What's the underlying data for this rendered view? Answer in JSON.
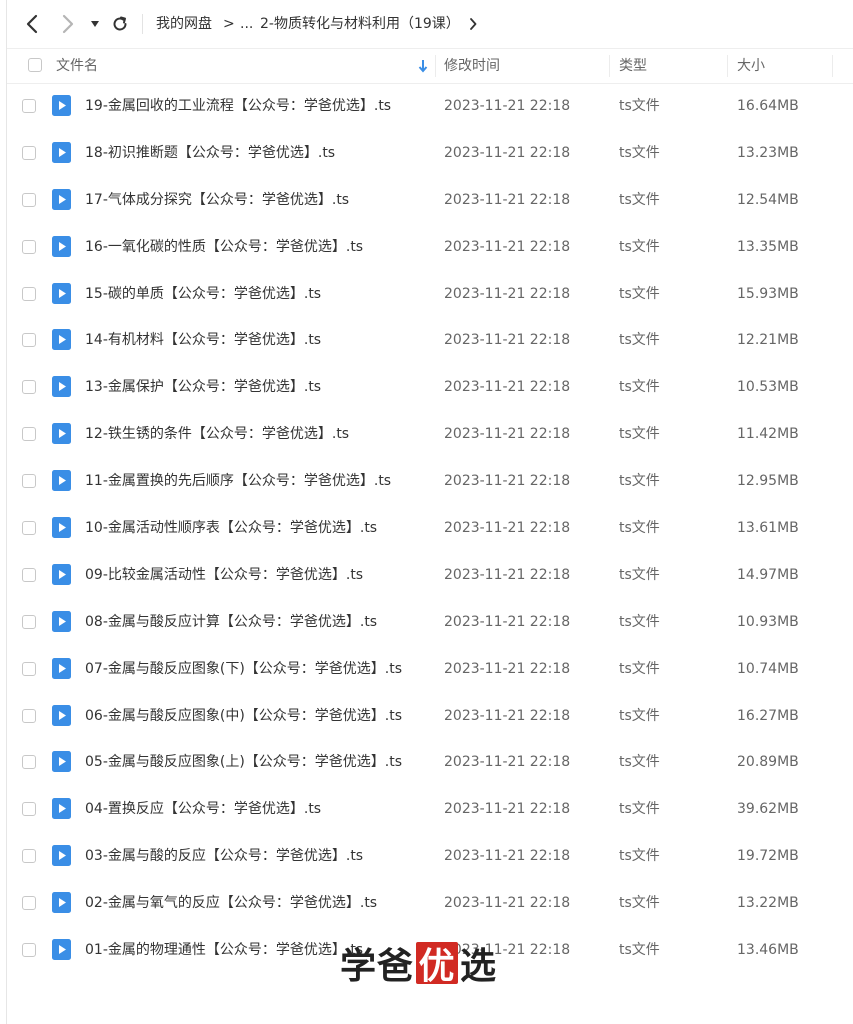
{
  "nav": {
    "back_icon": "chevron-left-icon",
    "forward_icon": "chevron-right-icon",
    "dropdown_icon": "caret-down-icon",
    "refresh_icon": "refresh-icon",
    "breadcrumb_root": "我的网盘",
    "breadcrumb_sep": ">",
    "breadcrumb_ellipsis": "...",
    "breadcrumb_current": "2-物质转化与材料利用（19课）",
    "breadcrumb_next_icon": "chevron-right-icon"
  },
  "header": {
    "name": "文件名",
    "sort_icon": "arrow-down-icon",
    "modified": "修改时间",
    "type": "类型",
    "size": "大小"
  },
  "colors": {
    "accent": "#3a8ee6",
    "watermark_red": "#d12a23"
  },
  "files": [
    {
      "name": "19-金属回收的工业流程【公众号：学爸优选】.ts",
      "date": "2023-11-21 22:18",
      "type": "ts文件",
      "size": "16.64MB"
    },
    {
      "name": "18-初识推断题【公众号：学爸优选】.ts",
      "date": "2023-11-21 22:18",
      "type": "ts文件",
      "size": "13.23MB"
    },
    {
      "name": "17-气体成分探究【公众号：学爸优选】.ts",
      "date": "2023-11-21 22:18",
      "type": "ts文件",
      "size": "12.54MB"
    },
    {
      "name": "16-一氧化碳的性质【公众号：学爸优选】.ts",
      "date": "2023-11-21 22:18",
      "type": "ts文件",
      "size": "13.35MB"
    },
    {
      "name": "15-碳的单质【公众号：学爸优选】.ts",
      "date": "2023-11-21 22:18",
      "type": "ts文件",
      "size": "15.93MB"
    },
    {
      "name": "14-有机材料【公众号：学爸优选】.ts",
      "date": "2023-11-21 22:18",
      "type": "ts文件",
      "size": "12.21MB"
    },
    {
      "name": "13-金属保护【公众号：学爸优选】.ts",
      "date": "2023-11-21 22:18",
      "type": "ts文件",
      "size": "10.53MB"
    },
    {
      "name": "12-铁生锈的条件【公众号：学爸优选】.ts",
      "date": "2023-11-21 22:18",
      "type": "ts文件",
      "size": "11.42MB"
    },
    {
      "name": "11-金属置换的先后顺序【公众号：学爸优选】.ts",
      "date": "2023-11-21 22:18",
      "type": "ts文件",
      "size": "12.95MB"
    },
    {
      "name": "10-金属活动性顺序表【公众号：学爸优选】.ts",
      "date": "2023-11-21 22:18",
      "type": "ts文件",
      "size": "13.61MB"
    },
    {
      "name": "09-比较金属活动性【公众号：学爸优选】.ts",
      "date": "2023-11-21 22:18",
      "type": "ts文件",
      "size": "14.97MB"
    },
    {
      "name": "08-金属与酸反应计算【公众号：学爸优选】.ts",
      "date": "2023-11-21 22:18",
      "type": "ts文件",
      "size": "10.93MB"
    },
    {
      "name": "07-金属与酸反应图象(下)【公众号：学爸优选】.ts",
      "date": "2023-11-21 22:18",
      "type": "ts文件",
      "size": "10.74MB"
    },
    {
      "name": "06-金属与酸反应图象(中)【公众号：学爸优选】.ts",
      "date": "2023-11-21 22:18",
      "type": "ts文件",
      "size": "16.27MB"
    },
    {
      "name": "05-金属与酸反应图象(上)【公众号：学爸优选】.ts",
      "date": "2023-11-21 22:18",
      "type": "ts文件",
      "size": "20.89MB"
    },
    {
      "name": "04-置换反应【公众号：学爸优选】.ts",
      "date": "2023-11-21 22:18",
      "type": "ts文件",
      "size": "39.62MB"
    },
    {
      "name": "03-金属与酸的反应【公众号：学爸优选】.ts",
      "date": "2023-11-21 22:18",
      "type": "ts文件",
      "size": "19.72MB"
    },
    {
      "name": "02-金属与氧气的反应【公众号：学爸优选】.ts",
      "date": "2023-11-21 22:18",
      "type": "ts文件",
      "size": "13.22MB"
    },
    {
      "name": "01-金属的物理通性【公众号：学爸优选】.ts",
      "date": "2023-11-21 22:18",
      "type": "ts文件",
      "size": "13.46MB"
    }
  ],
  "file_icon": "video-file-icon",
  "watermark": {
    "c1": "学",
    "c2": "爸",
    "c3": "优",
    "c4": "选"
  }
}
